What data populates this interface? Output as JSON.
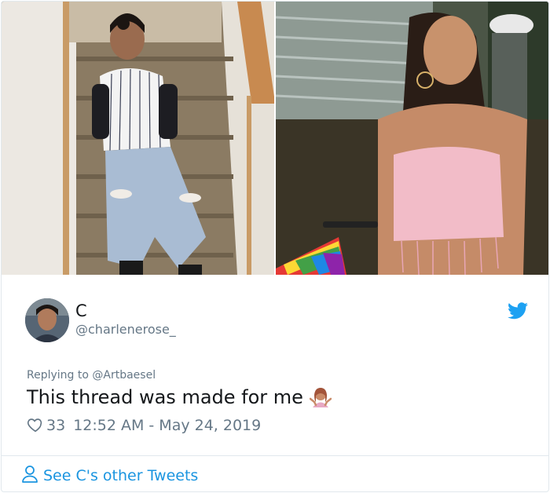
{
  "tweet": {
    "display_name": "C",
    "handle": "@charlenerose_",
    "reply_prefix": "Replying to ",
    "reply_to": "@Artbaesel",
    "text": "This thread was made for me",
    "emoji_icon": "person-shrugging-icon",
    "likes": "33",
    "timestamp": "12:52 AM - May 24, 2019"
  },
  "footer": {
    "see_more_label": "See C's other Tweets"
  },
  "colors": {
    "twitter_blue": "#1da1f2",
    "link_blue": "#1b95e0",
    "secondary_text": "#657786",
    "border": "#e1e8ed"
  }
}
